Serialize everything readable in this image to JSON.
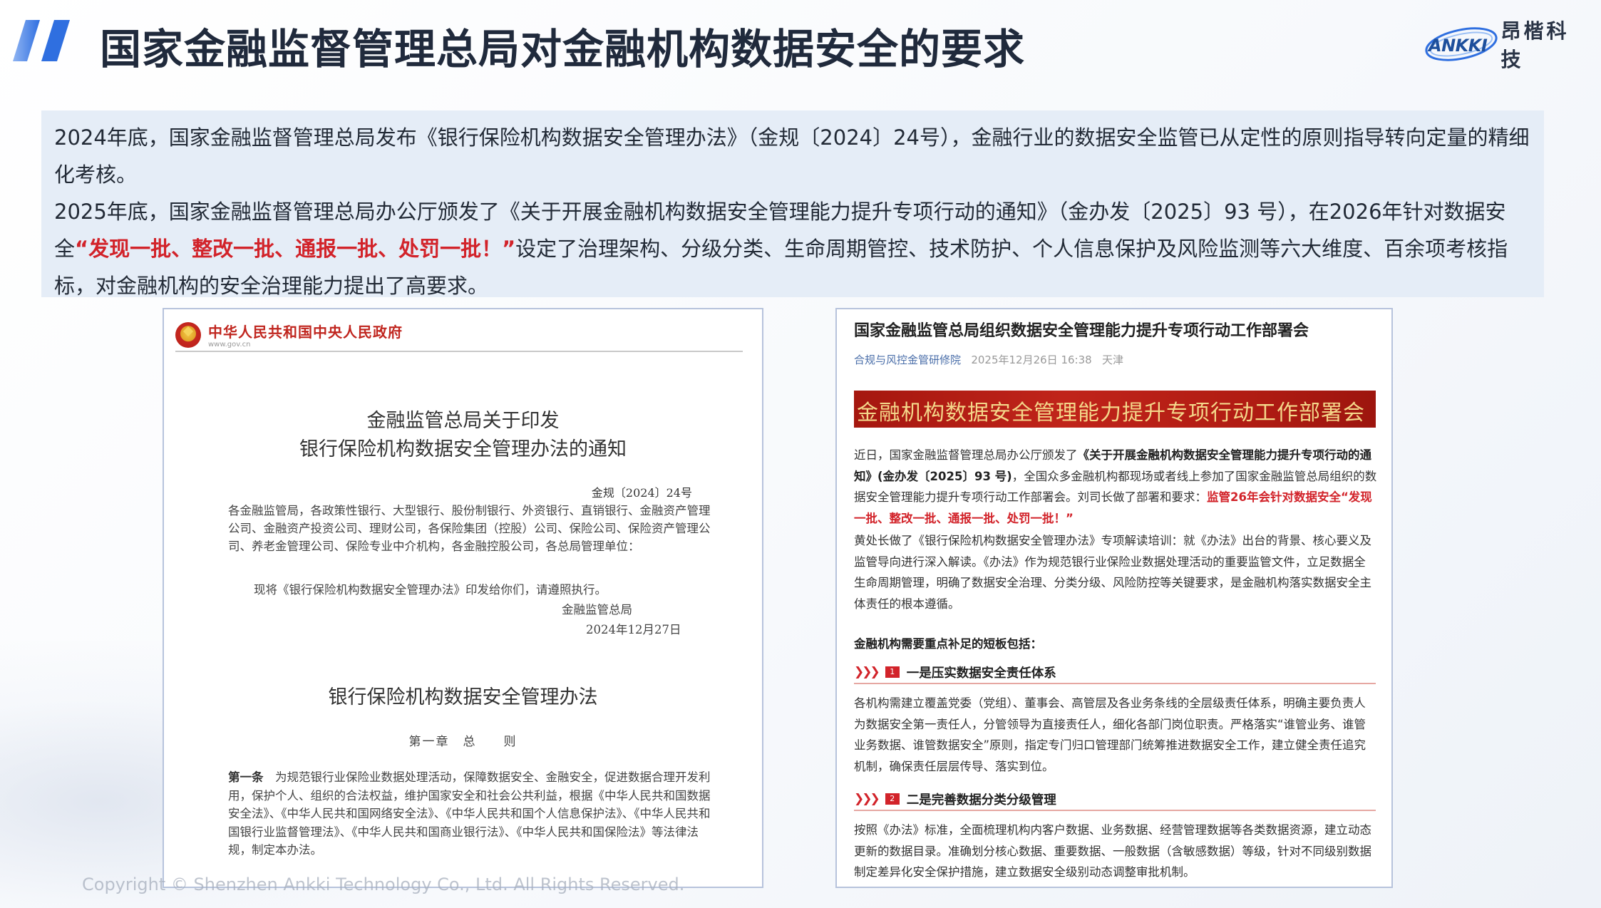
{
  "header": {
    "title": "国家金融监督管理总局对金融机构数据安全的要求",
    "brand_mark": "ANKKI",
    "brand_name": "昂楷科技"
  },
  "intro": {
    "p1": "2024年底，国家金融监督管理总局发布《银行保险机构数据安全管理办法》（金规〔2024〕24号），金融行业的数据安全监管已从定性的原则指导转向定量的精细化考核。",
    "p2_start": "2025年底，国家金融监督管理总局办公厅颁发了《关于开展金融机构数据安全管理能力提升专项行动的通知》（金办发〔2025〕93 号），在2026年针对数据安全",
    "p2_highlight": "“发现一批、整改一批、通报一批、处罚一批！”",
    "p2_end": "设定了治理架构、分级分类、生命周期管控、技术防护、个人信息保护及风险监测等六大维度、百余项考核指标，对金融机构的安全治理能力提出了高要求。"
  },
  "doc_left": {
    "site_name": "中华人民共和国中央人民政府",
    "site_url": "www.gov.cn",
    "title_line1": "金融监管总局关于印发",
    "title_line2": "银行保险机构数据安全管理办法的通知",
    "doc_number": "金规〔2024〕24号",
    "recipients": "各金融监管局，各政策性银行、大型银行、股份制银行、外资银行、直销银行、金融资产管理公司、金融资产投资公司、理财公司，各保险集团（控股）公司、保险公司、保险资产管理公司、养老金管理公司、保险专业中介机构，各金融控股公司，各总局管理单位：",
    "instruction": "现将《银行保险机构数据安全管理办法》印发给你们，请遵照执行。",
    "signer": "金融监管总局",
    "date": "2024年12月27日",
    "law_title": "银行保险机构数据安全管理办法",
    "chapter": "第一章　总　　则",
    "article_label": "第一条",
    "article_text": "为规范银行业保险业数据处理活动，保障数据安全、金融安全，促进数据合理开发利用，保护个人、组织的合法权益，维护国家安全和社会公共利益，根据《中华人民共和国数据安全法》、《中华人民共和国网络安全法》、《中华人民共和国个人信息保护法》、《中华人民共和国银行业监督管理法》、《中华人民共和国商业银行法》、《中华人民共和国保险法》等法律法规，制定本办法。"
  },
  "doc_right": {
    "title": "国家金融监管总局组织数据安全管理能力提升专项行动工作部署会",
    "source": "合规与风控金管研修院",
    "datetime": "2025年12月26日 16:38",
    "location": "天津",
    "banner": "金融机构数据安全管理能力提升专项行动工作部署会",
    "p1_a": "近日，国家金融监督管理总局办公厅颁发了",
    "p1_b": "《关于开展金融机构数据安全管理能力提升专项行动的通知》(金办发〔2025〕93 号)",
    "p1_c": "，全国众多金融机构都现场或者线上参加了国家金融监管总局组织的数据安全管理能力提升专项行动工作部署会。刘司长做了部署和要求：",
    "p1_d": "监管26年会针对数据安全“发现一批、整改一批、通报一批、处罚一批！”",
    "p2": "黄处长做了《银行保险机构数据安全管理办法》专项解读培训：就《办法》出台的背景、核心要义及监管导向进行深入解读。《办法》作为规范银行业保险业数据处理活动的重要监管文件，立足数据全生命周期管理，明确了数据安全治理、分类分级、风险防控等关键要求，是金融机构落实数据安全主体责任的根本遵循。",
    "subhead": "金融机构需要重点补足的短板包括：",
    "sec1_num": "1",
    "sec1_title": "一是压实数据安全责任体系",
    "sec1_text": "各机构需建立覆盖党委（党组）、董事会、高管层及各业务条线的全层级责任体系，明确主要负责人为数据安全第一责任人，分管领导为直接责任人，细化各部门岗位职责。严格落实“谁管业务、谁管业务数据、谁管数据安全”原则，指定专门归口管理部门统筹推进数据安全工作，建立健全责任追究机制，确保责任层层传导、落实到位。",
    "sec2_num": "2",
    "sec2_title": "二是完善数据分类分级管理",
    "sec2_text": "按照《办法》标准，全面梳理机构内客户数据、业务数据、经营管理数据等各类数据资源，建立动态更新的数据目录。准确划分核心数据、重要数据、一般数据（含敏感数据）等级，针对不同级别数据制定差异化安全保护措施，建立数据安全级别动态调整审批机制。"
  },
  "footer": {
    "copyright": "Copyright © Shenzhen Ankki Technology Co., Ltd. All Rights Reserved."
  },
  "colors": {
    "accent_blue": "#2f6fe0",
    "highlight_red": "#d2232a",
    "intro_bg": "#e5edf7"
  }
}
